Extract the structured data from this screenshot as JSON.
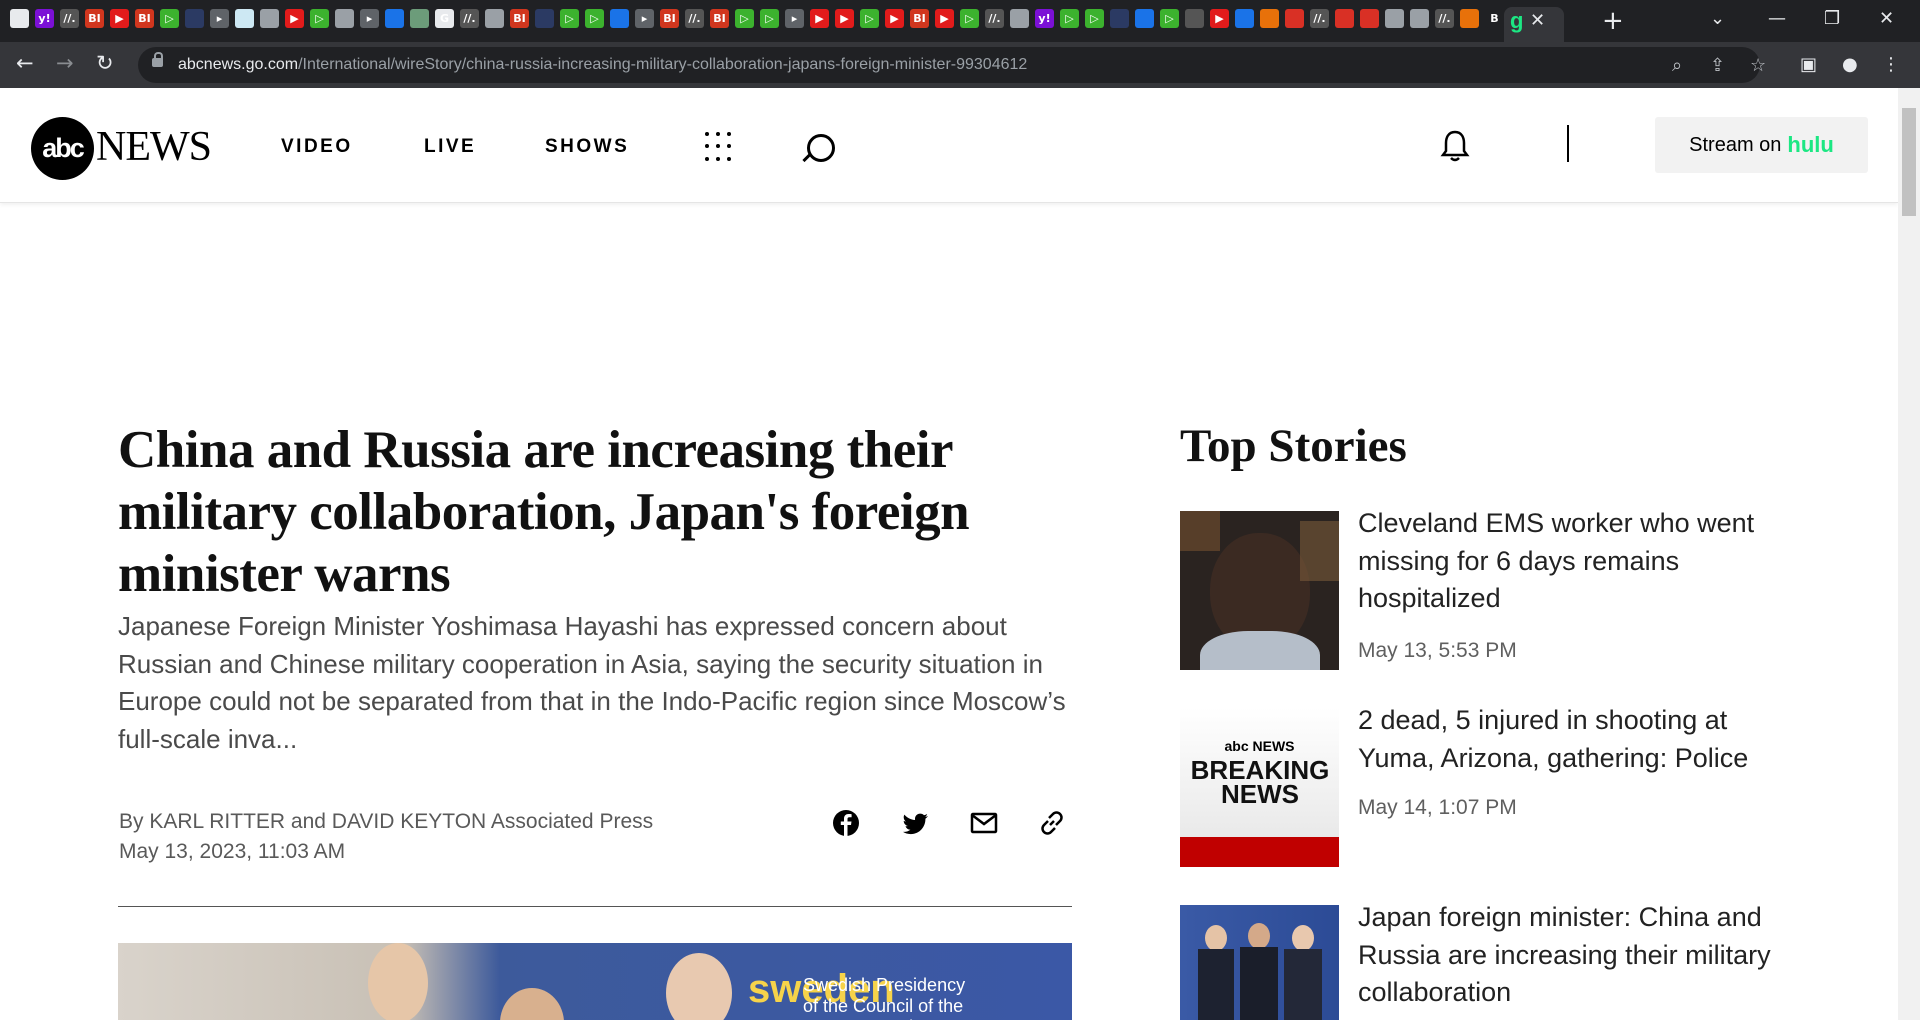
{
  "browser": {
    "tab_favicons": [
      {
        "glyph": "",
        "color": "#e8eaed"
      },
      {
        "glyph": "y!",
        "color": "#7b10d6"
      },
      {
        "glyph": "//.",
        "color": "#555"
      },
      {
        "glyph": "BI",
        "color": "#d1361e"
      },
      {
        "glyph": "▶",
        "color": "#e21b1b"
      },
      {
        "glyph": "BI",
        "color": "#d1361e"
      },
      {
        "glyph": "▷",
        "color": "#3cb22e"
      },
      {
        "glyph": "",
        "color": "#2b3a63"
      },
      {
        "glyph": "▸",
        "color": "#5f6368"
      },
      {
        "glyph": "",
        "color": "#cde8f3"
      },
      {
        "glyph": "",
        "color": "#9aa0a6"
      },
      {
        "glyph": "▶",
        "color": "#e21b1b"
      },
      {
        "glyph": "▷",
        "color": "#3cb22e"
      },
      {
        "glyph": "",
        "color": "#9aa0a6"
      },
      {
        "glyph": "▸",
        "color": "#5f6368"
      },
      {
        "glyph": "",
        "color": "#1a73e8"
      },
      {
        "glyph": "",
        "color": "#6c9c7a"
      },
      {
        "glyph": "G",
        "color": "#e8eaed"
      },
      {
        "glyph": "//.",
        "color": "#555"
      },
      {
        "glyph": "",
        "color": "#9aa0a6"
      },
      {
        "glyph": "BI",
        "color": "#d1361e"
      },
      {
        "glyph": "",
        "color": "#2b3a63"
      },
      {
        "glyph": "▷",
        "color": "#3cb22e"
      },
      {
        "glyph": "▷",
        "color": "#3cb22e"
      },
      {
        "glyph": "",
        "color": "#1a73e8"
      },
      {
        "glyph": "▸",
        "color": "#5f6368"
      },
      {
        "glyph": "BI",
        "color": "#d1361e"
      },
      {
        "glyph": "//.",
        "color": "#555"
      },
      {
        "glyph": "BI",
        "color": "#d1361e"
      },
      {
        "glyph": "▷",
        "color": "#3cb22e"
      },
      {
        "glyph": "▷",
        "color": "#3cb22e"
      },
      {
        "glyph": "▸",
        "color": "#5f6368"
      },
      {
        "glyph": "▶",
        "color": "#e21b1b"
      },
      {
        "glyph": "▶",
        "color": "#e21b1b"
      },
      {
        "glyph": "▷",
        "color": "#3cb22e"
      },
      {
        "glyph": "▶",
        "color": "#e21b1b"
      },
      {
        "glyph": "BI",
        "color": "#d1361e"
      },
      {
        "glyph": "▶",
        "color": "#e21b1b"
      },
      {
        "glyph": "▷",
        "color": "#3cb22e"
      },
      {
        "glyph": "//.",
        "color": "#555"
      },
      {
        "glyph": "",
        "color": "#9aa0a6"
      },
      {
        "glyph": "y!",
        "color": "#7b10d6"
      },
      {
        "glyph": "▷",
        "color": "#3cb22e"
      },
      {
        "glyph": "▷",
        "color": "#3cb22e"
      },
      {
        "glyph": "",
        "color": "#2b3a63"
      },
      {
        "glyph": "",
        "color": "#1a73e8"
      },
      {
        "glyph": "▷",
        "color": "#3cb22e"
      },
      {
        "glyph": "",
        "color": "#555"
      },
      {
        "glyph": "▶",
        "color": "#e21b1b"
      },
      {
        "glyph": "",
        "color": "#1a73e8"
      },
      {
        "glyph": "",
        "color": "#e8710a"
      },
      {
        "glyph": "",
        "color": "#d93025"
      },
      {
        "glyph": "//.",
        "color": "#555"
      },
      {
        "glyph": "",
        "color": "#d93025"
      },
      {
        "glyph": "",
        "color": "#d93025"
      },
      {
        "glyph": "",
        "color": "#9aa0a6"
      },
      {
        "glyph": "",
        "color": "#9aa0a6"
      },
      {
        "glyph": "//.",
        "color": "#555"
      },
      {
        "glyph": "",
        "color": "#e8710a"
      },
      {
        "glyph": "B",
        "color": "#202124"
      },
      {
        "glyph": "y!",
        "color": "#7b10d6"
      }
    ],
    "active_tab_favicon": "g",
    "active_tab_favicon_color": "#1ce783",
    "tab_close_glyph": "✕",
    "new_tab_glyph": "+",
    "window_controls": [
      "⌄",
      "—",
      "❐",
      "✕"
    ],
    "url_host": "abcnews.go.com",
    "url_path": "/International/wireStory/china-russia-increasing-military-collaboration-japans-foreign-minister-99304612"
  },
  "site": {
    "logo_mark": "abc",
    "logo_word": "NEWS",
    "nav": [
      "VIDEO",
      "LIVE",
      "SHOWS"
    ],
    "stream_prefix": "Stream on",
    "stream_brand": "hulu"
  },
  "article": {
    "headline": "China and Russia are increasing their military collaboration, Japan's foreign minister warns",
    "summary": "Japanese Foreign Minister Yoshimasa Hayashi has expressed concern about Russian and Chinese military cooperation in Asia, saying the security situation in Europe could not be separated from that in the Indo-Pacific region since Moscow’s full-scale inva...",
    "byline": "By KARL RITTER and DAVID KEYTON Associated Press",
    "date": "May 13, 2023, 11:03 AM",
    "image_text_sweden": "sweden",
    "image_text_presidency": "Swedish Presidency\nof the Council of the\nEuropean Union"
  },
  "top_stories": {
    "title": "Top Stories",
    "items": [
      {
        "title": "Cleveland EMS worker who went missing for 6 days remains hospitalized",
        "date": "May 13, 5:53 PM"
      },
      {
        "title": "2 dead, 5 injured in shooting at Yuma, Arizona, gathering: Police",
        "date": "May 14, 1:07 PM",
        "thumb_label": "BREAKING NEWS",
        "thumb_logo": "abc NEWS"
      },
      {
        "title": "Japan foreign minister: China and Russia are increasing their military collaboration",
        "date": ""
      }
    ]
  },
  "colors": {
    "hulu_green": "#1ce783",
    "chrome_dark": "#202124",
    "chrome_toolbar": "#35363a",
    "breaking_red": "#c00000"
  }
}
